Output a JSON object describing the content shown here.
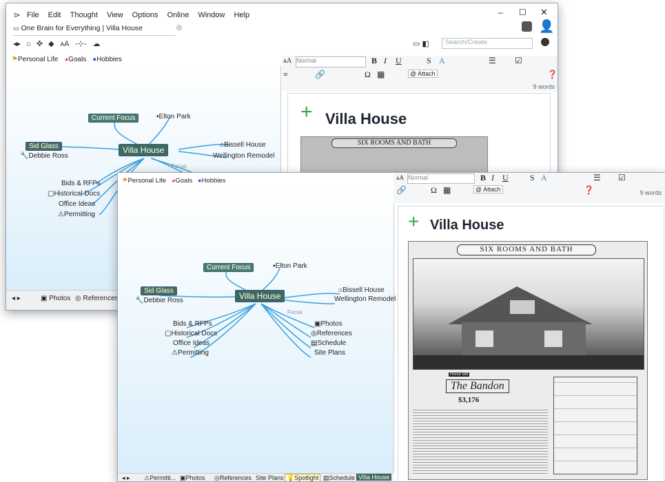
{
  "back_window": {
    "menu": [
      "File",
      "Edit",
      "Thought",
      "View",
      "Options",
      "Online",
      "Window",
      "Help"
    ],
    "tab_title": "One Brain for Everything | Villa House",
    "search_placeholder": "Search/Create",
    "pins": [
      "Personal Life",
      "Goals",
      "Hobbies"
    ],
    "style_value": "Normal",
    "attach_label": "Attach",
    "word_count": "9 words",
    "doc_title": "Villa House",
    "sheet_header": "SIX ROOMS AND BATH",
    "map": {
      "active": "Villa House",
      "parents": [
        "Current Focus",
        "Elton Park"
      ],
      "jumps": [
        "Sid Glass",
        "Debbie Ross"
      ],
      "right": [
        "Bissell House",
        "Wellington Remodel"
      ],
      "children": [
        "Bids & RFPs",
        "Historical Docs",
        "Office Ideas",
        "Permitting"
      ],
      "link_label": "Focus"
    },
    "footer": [
      "Photos",
      "References"
    ]
  },
  "front_window": {
    "pins": [
      "Personal Life",
      "Goals",
      "Hobbies"
    ],
    "style_value": "Normal",
    "attach_label": "Attach",
    "word_count": "9 words",
    "doc_title": "Villa House",
    "sheet_header": "SIX ROOMS AND BATH",
    "sheet_badge": "Honor Bilt",
    "sheet_name": "The Bandon",
    "sheet_price": "$3,176",
    "map": {
      "active": "Villa House",
      "parents": [
        "Current Focus",
        "Elton Park"
      ],
      "jumps": [
        "Sid Glass",
        "Debbie Ross"
      ],
      "right": [
        "Bissell House",
        "Wellington Remodel"
      ],
      "children_left": [
        "Bids & RFPs",
        "Historical Docs",
        "Office Ideas",
        "Permitting"
      ],
      "children_right": [
        "Photos",
        "References",
        "Schedule",
        "Site Plans"
      ],
      "link_label": "Focus"
    },
    "footer": [
      "Permitti...",
      "Photos",
      "References",
      "Site Plans",
      "Spotlight",
      "Schedule",
      "Villa House"
    ]
  },
  "colors": {
    "accent": "#3a8fd0",
    "active_node": "#3f6a5a",
    "plus": "#35a84a"
  }
}
